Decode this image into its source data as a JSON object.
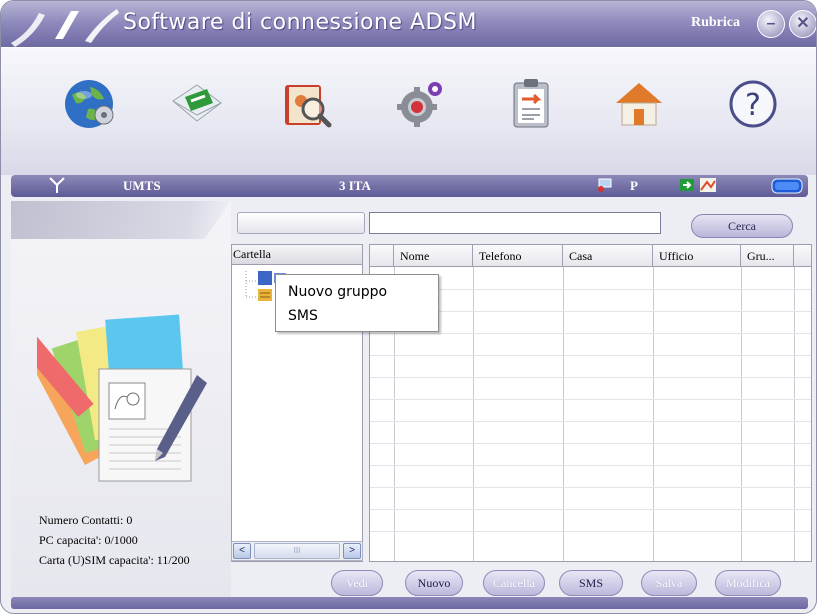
{
  "window": {
    "title": "Software di connessione ADSM",
    "section": "Rubrica",
    "minimize_glyph": "–",
    "close_glyph": "✕"
  },
  "toolbar": {
    "tools": [
      {
        "icon": "globe-connect-icon"
      },
      {
        "icon": "sms-envelope-icon"
      },
      {
        "icon": "phonebook-search-icon"
      },
      {
        "icon": "settings-gear-icon"
      },
      {
        "icon": "clipboard-icon"
      },
      {
        "icon": "home-icon"
      },
      {
        "icon": "help-icon"
      }
    ]
  },
  "status": {
    "network_type": "UMTS",
    "operator": "3 ITA",
    "roaming_indicator": "P"
  },
  "search": {
    "button_label": "Cerca",
    "value": ""
  },
  "tree": {
    "header": "Cartella"
  },
  "grid": {
    "columns": [
      "Nome",
      "Telefono",
      "Casa",
      "Ufficio",
      "Gru..."
    ]
  },
  "context_menu": {
    "items": [
      "Nuovo gruppo",
      "SMS"
    ]
  },
  "info": {
    "contacts": "Numero Contatti: 0",
    "pc_capacity": "PC capacita': 0/1000",
    "sim_capacity": "Carta (U)SIM capacita': 11/200"
  },
  "buttons": {
    "view": "Vedi",
    "new": "Nuovo",
    "delete": "Cancella",
    "sms": "SMS",
    "save": "Salva",
    "edit": "Modifica"
  },
  "scroll": {
    "left": "<",
    "right": ">",
    "grip": "III"
  },
  "colors": {
    "title_bar": "#7d79b0",
    "accent": "#5e5a96",
    "panel": "#eceef4"
  }
}
